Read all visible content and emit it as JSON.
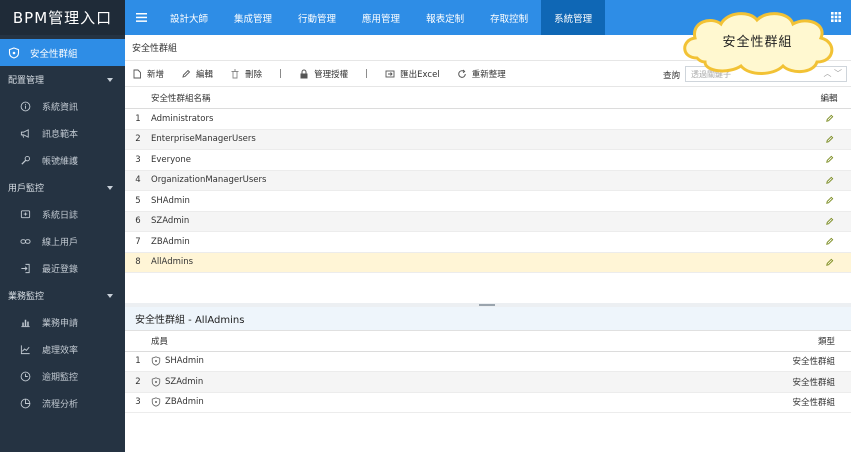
{
  "app": {
    "brand": "BPM管理入口"
  },
  "sidebar": {
    "active_item": "安全性群組",
    "groups": [
      {
        "label": "配置管理",
        "items": [
          {
            "label": "系統資訊",
            "icon": "info-icon"
          },
          {
            "label": "訊息範本",
            "icon": "megaphone-icon"
          },
          {
            "label": "帳號維護",
            "icon": "wrench-icon"
          }
        ]
      },
      {
        "label": "用戶監控",
        "items": [
          {
            "label": "系統日誌",
            "icon": "log-icon"
          },
          {
            "label": "線上用戶",
            "icon": "link-icon"
          },
          {
            "label": "最近登錄",
            "icon": "login-icon"
          }
        ]
      },
      {
        "label": "業務監控",
        "items": [
          {
            "label": "業務申請",
            "icon": "bar-chart-icon"
          },
          {
            "label": "處理效率",
            "icon": "line-chart-icon"
          },
          {
            "label": "逾期監控",
            "icon": "clock-icon"
          },
          {
            "label": "流程分析",
            "icon": "pie-chart-icon"
          }
        ]
      }
    ]
  },
  "topnav": {
    "tabs": [
      "設計大師",
      "集成管理",
      "行動管理",
      "應用管理",
      "報表定制",
      "存取控制",
      "系統管理"
    ],
    "active_tab": "系統管理"
  },
  "page": {
    "title": "安全性群組"
  },
  "toolbar": {
    "new_label": "新增",
    "edit_label": "編輯",
    "delete_label": "刪除",
    "admin_label": "管理授權",
    "export_label": "匯出Excel",
    "refresh_label": "重新整理",
    "search_label": "查詢",
    "search_placeholder": "透過關鍵子"
  },
  "groups_table": {
    "col_name": "安全性群組名稱",
    "col_edit": "編輯",
    "rows": [
      {
        "idx": "1",
        "name": "Administrators"
      },
      {
        "idx": "2",
        "name": "EnterpriseManagerUsers"
      },
      {
        "idx": "3",
        "name": "Everyone"
      },
      {
        "idx": "4",
        "name": "OrganizationManagerUsers"
      },
      {
        "idx": "5",
        "name": "SHAdmin"
      },
      {
        "idx": "6",
        "name": "SZAdmin"
      },
      {
        "idx": "7",
        "name": "ZBAdmin"
      },
      {
        "idx": "8",
        "name": "AllAdmins"
      }
    ],
    "selected_row": 8
  },
  "members": {
    "title": "安全性群組 - AllAdmins",
    "col_member": "成員",
    "col_type": "類型",
    "rows": [
      {
        "idx": "1",
        "name": "SHAdmin",
        "type": "安全性群組"
      },
      {
        "idx": "2",
        "name": "SZAdmin",
        "type": "安全性群組"
      },
      {
        "idx": "3",
        "name": "ZBAdmin",
        "type": "安全性群組"
      }
    ]
  },
  "callout": {
    "text": "安全性群組"
  },
  "colors": {
    "primary": "#2e8de6",
    "active_tab": "#0f67b5",
    "sidebar": "#253342",
    "selected_row": "#fff5d6"
  }
}
